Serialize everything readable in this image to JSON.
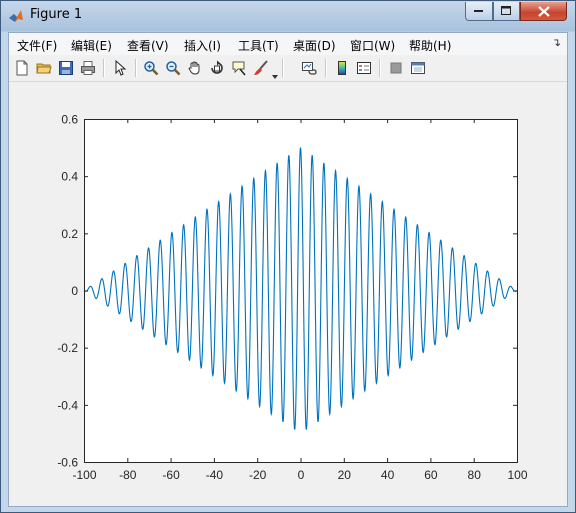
{
  "window": {
    "title": "Figure 1"
  },
  "menu": {
    "items": [
      "文件(F)",
      "编辑(E)",
      "查看(V)",
      "插入(I)",
      "工具(T)",
      "桌面(D)",
      "窗口(W)",
      "帮助(H)"
    ]
  },
  "toolbar": {
    "icons": [
      "new-file-icon",
      "open-folder-icon",
      "save-icon",
      "print-icon",
      "pointer-icon",
      "zoom-in-icon",
      "zoom-out-icon",
      "pan-hand-icon",
      "rotate-3d-icon",
      "data-cursor-icon",
      "brush-icon",
      "link-plot-icon",
      "colorbar-icon",
      "legend-icon",
      "hide-tools-icon",
      "show-tools-icon"
    ]
  },
  "chart_data": {
    "type": "line",
    "title": "",
    "xlabel": "",
    "ylabel": "",
    "xlim": [
      -100,
      100
    ],
    "ylim": [
      -0.6,
      0.6
    ],
    "xticks": [
      -100,
      -80,
      -60,
      -40,
      -20,
      0,
      20,
      40,
      60,
      80,
      100
    ],
    "yticks": [
      0.6,
      0.4,
      0.2,
      0,
      -0.2,
      -0.4,
      -0.6
    ],
    "grid": false,
    "series": [
      {
        "formula": "y = 0.5*(1-|x|/100)*cos(2*pi*x/5.4)",
        "color": "#0072bd",
        "x_range": [
          -100,
          100
        ]
      }
    ]
  }
}
